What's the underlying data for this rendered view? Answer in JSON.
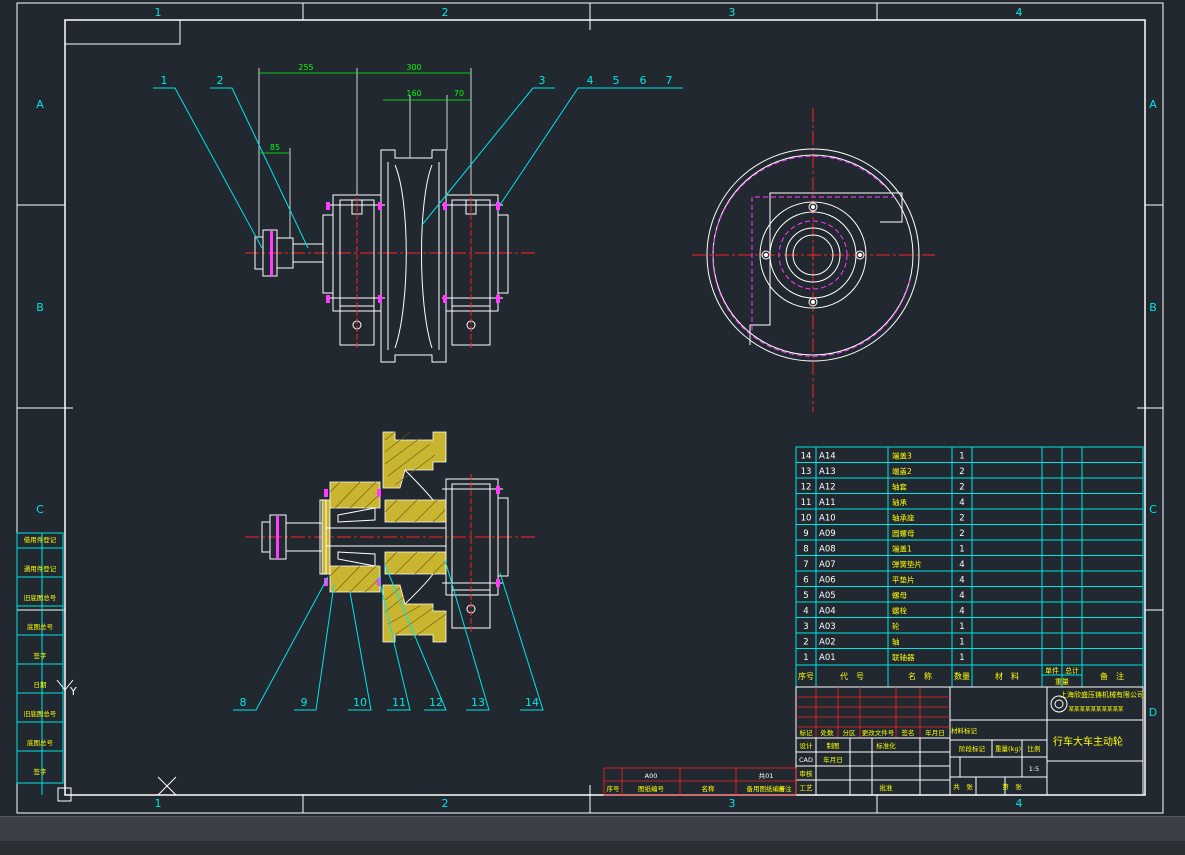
{
  "colors": {
    "bg": "#212830",
    "line": "#ffffff",
    "dim": "#00ff00",
    "leader": "#00e5e5",
    "center": "#ff2020",
    "hidden": "#ff3cff",
    "section": "#e8d84a",
    "table": "#00e5e5",
    "tableText": "#ffff00",
    "white": "#ffffff"
  },
  "border": {
    "columns": [
      "1",
      "2",
      "3",
      "4"
    ],
    "rows": [
      "A",
      "B",
      "C",
      "D"
    ]
  },
  "dimensions": {
    "d255": "255",
    "d300": "300",
    "d160": "160",
    "d70": "70",
    "d85": "85"
  },
  "callouts_top": [
    "1",
    "2",
    "3",
    "4",
    "5",
    "6",
    "7"
  ],
  "callouts_bottom": [
    "8",
    "9",
    "10",
    "11",
    "12",
    "13",
    "14"
  ],
  "bom": [
    {
      "no": "14",
      "code": "A14",
      "name": "端盖3",
      "qty": "1"
    },
    {
      "no": "13",
      "code": "A13",
      "name": "端盖2",
      "qty": "2"
    },
    {
      "no": "12",
      "code": "A12",
      "name": "轴套",
      "qty": "2"
    },
    {
      "no": "11",
      "code": "A11",
      "name": "轴承",
      "qty": "4"
    },
    {
      "no": "10",
      "code": "A10",
      "name": "轴承座",
      "qty": "2"
    },
    {
      "no": "9",
      "code": "A09",
      "name": "圆螺母",
      "qty": "2"
    },
    {
      "no": "8",
      "code": "A08",
      "name": "端盖1",
      "qty": "1"
    },
    {
      "no": "7",
      "code": "A07",
      "name": "弹簧垫片",
      "qty": "4"
    },
    {
      "no": "6",
      "code": "A06",
      "name": "平垫片",
      "qty": "4"
    },
    {
      "no": "5",
      "code": "A05",
      "name": "螺母",
      "qty": "4"
    },
    {
      "no": "4",
      "code": "A04",
      "name": "螺栓",
      "qty": "4"
    },
    {
      "no": "3",
      "code": "A03",
      "name": "轮",
      "qty": "1"
    },
    {
      "no": "2",
      "code": "A02",
      "name": "轴",
      "qty": "1"
    },
    {
      "no": "1",
      "code": "A01",
      "name": "联轴器",
      "qty": "1"
    }
  ],
  "bom_header": {
    "no": "序号",
    "code": "代　号",
    "name": "名　称",
    "qty": "数量",
    "material": "材　料",
    "single": "单件",
    "total": "总计",
    "weight": "重量",
    "remark": "备　注"
  },
  "title_block": {
    "company": "上海欣盛压铸机械有限公司",
    "company_sub": "某某某某某某某某某某",
    "drawing_title": "行车大车主动轮",
    "scale": "1:5",
    "marks": "阶段标记",
    "weight_label": "重量(kg)",
    "ratio_label": "比例",
    "sheet_total": "共　张",
    "sheet_no": "第　张",
    "material_mark": "材料标记",
    "design": "设计",
    "drafting": "制图",
    "check": "审核",
    "process": "工艺",
    "approve": "批准",
    "cad": "CAD",
    "date1": "年月日",
    "std": "标准化",
    "revision_cols": [
      "标记",
      "处数",
      "分区",
      "更改文件号",
      "签名",
      "年月日"
    ]
  },
  "lower_strip": {
    "code": "A00",
    "sheet": "共01",
    "labels": [
      "序号",
      "图纸编号",
      "名称",
      "备用图纸编号",
      "备注"
    ]
  },
  "left_strip": [
    "借用件登记",
    "通用件登记",
    "旧底图总号",
    "底图总号",
    "签字",
    "日期"
  ],
  "axes": {
    "y": "Y",
    "x": "X"
  }
}
